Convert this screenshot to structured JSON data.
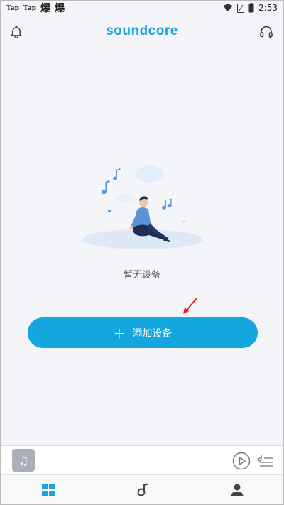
{
  "status_bar": {
    "app1": "Tap",
    "app2": "Tap",
    "glyph1": "爆",
    "glyph2": "爆",
    "time": "2:53",
    "icons": [
      "wifi-icon",
      "sim-icon",
      "battery-icon"
    ]
  },
  "header": {
    "logo": "soundcore",
    "left_icon": "bell-icon",
    "right_icon": "headset-icon"
  },
  "empty_state": {
    "illustration": "person-with-music-notes",
    "text": "暂无设备"
  },
  "add_button": {
    "icon": "plus-icon",
    "label": "添加设备"
  },
  "player": {
    "album_icon": "music-note-icon",
    "play_icon": "play-icon",
    "playlist_icon": "playlist-icon"
  },
  "bottom_nav": {
    "items": [
      "grid-icon",
      "music-icon",
      "profile-icon"
    ]
  },
  "colors": {
    "brand": "#1aa3dd",
    "button": "#14a6df",
    "annotation_arrow": "#e21b1b"
  }
}
